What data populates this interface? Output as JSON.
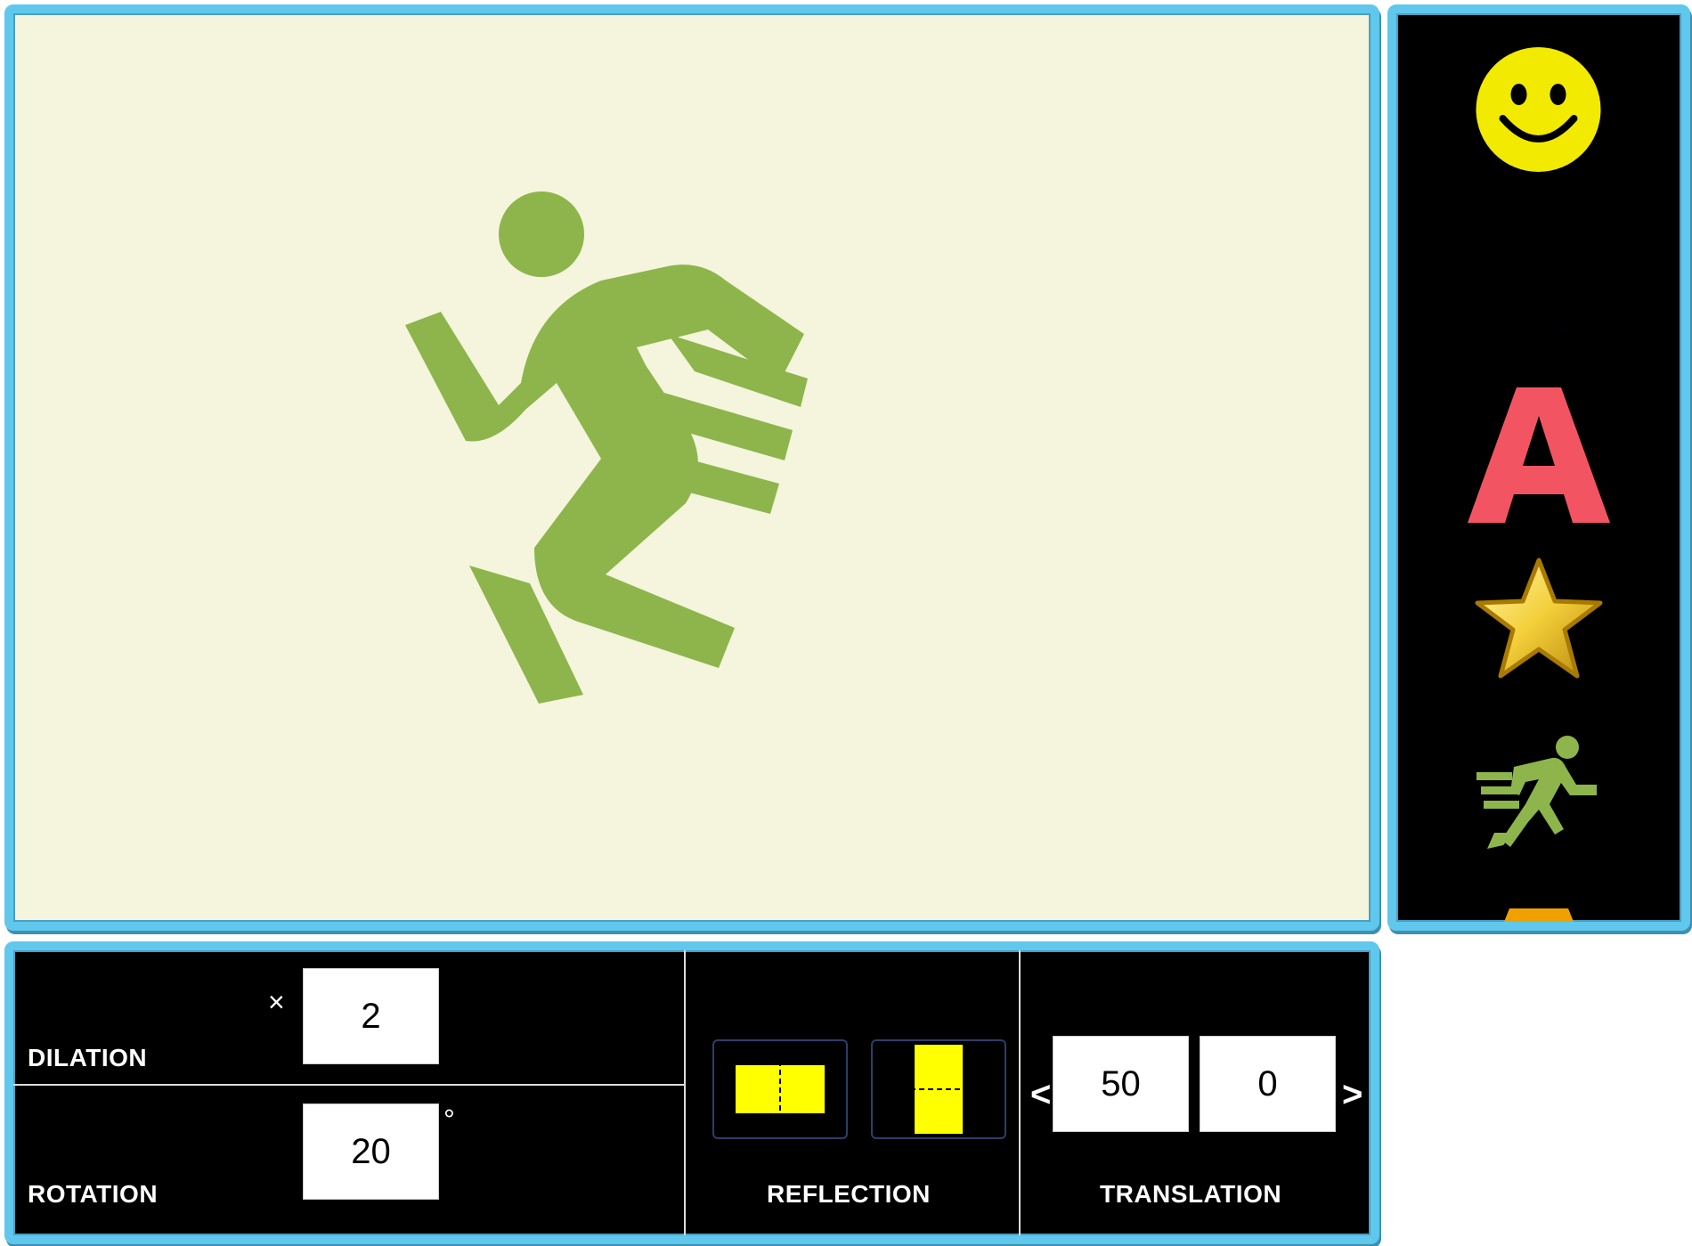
{
  "palette": {
    "items": [
      {
        "icon": "smiley-face-icon",
        "color": "#f2ea00"
      },
      {
        "icon": "crescent-moon-icon",
        "color": "#0000ee"
      },
      {
        "icon": "letter-a-icon",
        "color": "#f25561",
        "text": "A"
      },
      {
        "icon": "gold-star-icon",
        "color": "#e6b800"
      },
      {
        "icon": "running-person-icon",
        "color": "#8db54c"
      },
      {
        "icon": "orange-shape-icon",
        "color": "#f0a000"
      }
    ]
  },
  "canvas": {
    "shape": "running-person-icon",
    "shape_color": "#8db54c",
    "background": "#f4f5dc"
  },
  "controls": {
    "dilation": {
      "label": "DILATION",
      "symbol": "×",
      "value": "2"
    },
    "rotation": {
      "label": "ROTATION",
      "value": "20",
      "unit": "°"
    },
    "reflection": {
      "label": "REFLECTION"
    },
    "translation": {
      "label": "TRANSLATION",
      "left_arrow": "<",
      "right_arrow": ">",
      "x": "50",
      "y": "0"
    }
  },
  "colors": {
    "frame": "#5fc8ec",
    "reflect_fill": "#ffff00"
  }
}
